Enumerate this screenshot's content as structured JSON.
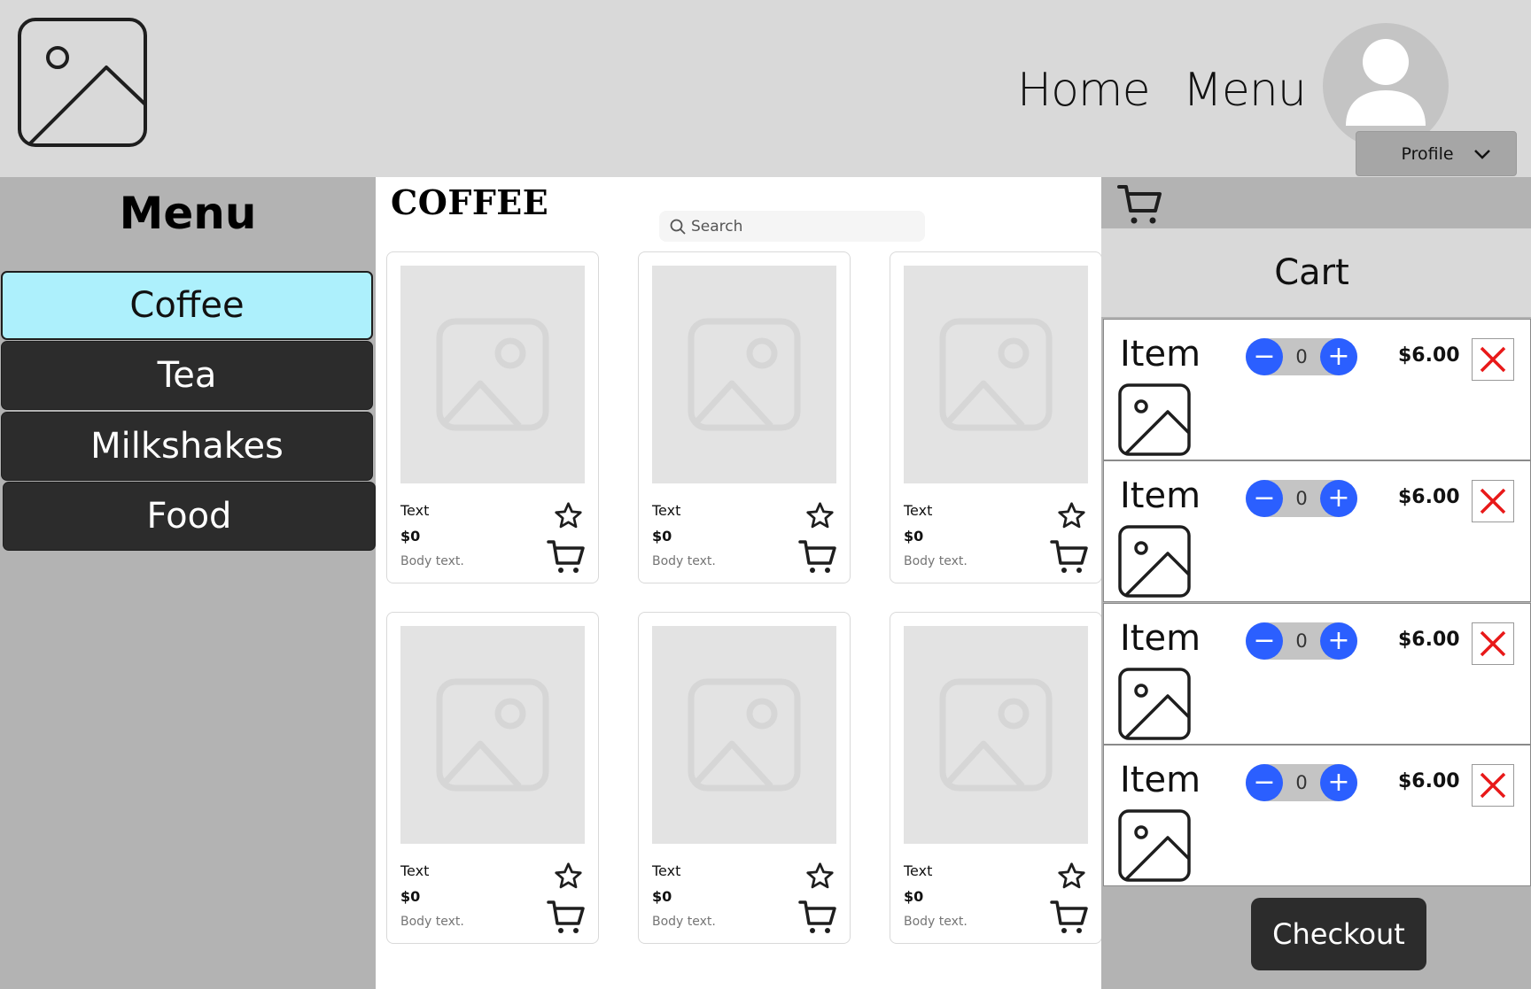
{
  "header": {
    "logo_icon": "image-placeholder-icon",
    "nav": [
      {
        "label": "Home"
      },
      {
        "label": "Menu"
      }
    ],
    "avatar_icon": "user-icon",
    "profile_label": "Profile",
    "profile_icon": "chevron-down-icon"
  },
  "sidebar": {
    "title": "Menu",
    "items": [
      {
        "label": "Coffee",
        "active": true
      },
      {
        "label": "Tea",
        "active": false
      },
      {
        "label": "Milkshakes",
        "active": false
      },
      {
        "label": "Food",
        "active": false
      }
    ],
    "active_color": "#adf0fc"
  },
  "main": {
    "title": "COFFEE",
    "search": {
      "placeholder": "Search",
      "icon": "search-icon"
    },
    "products": [
      {
        "text": "Text",
        "price": "$0",
        "body": "Body text."
      },
      {
        "text": "Text",
        "price": "$0",
        "body": "Body text."
      },
      {
        "text": "Text",
        "price": "$0",
        "body": "Body text."
      },
      {
        "text": "Text",
        "price": "$0",
        "body": "Body text."
      },
      {
        "text": "Text",
        "price": "$0",
        "body": "Body text."
      },
      {
        "text": "Text",
        "price": "$0",
        "body": "Body text."
      }
    ]
  },
  "cart": {
    "icon": "cart-icon",
    "title": "Cart",
    "items": [
      {
        "label": "Item",
        "qty": "0",
        "price": "$6.00"
      },
      {
        "label": "Item",
        "qty": "0",
        "price": "$6.00"
      },
      {
        "label": "Item",
        "qty": "0",
        "price": "$6.00"
      },
      {
        "label": "Item",
        "qty": "0",
        "price": "$6.00"
      }
    ],
    "minus_label": "−",
    "plus_label": "+",
    "stepper_color": "#2b5fff",
    "remove_color": "#e81919",
    "checkout_label": "Checkout"
  }
}
